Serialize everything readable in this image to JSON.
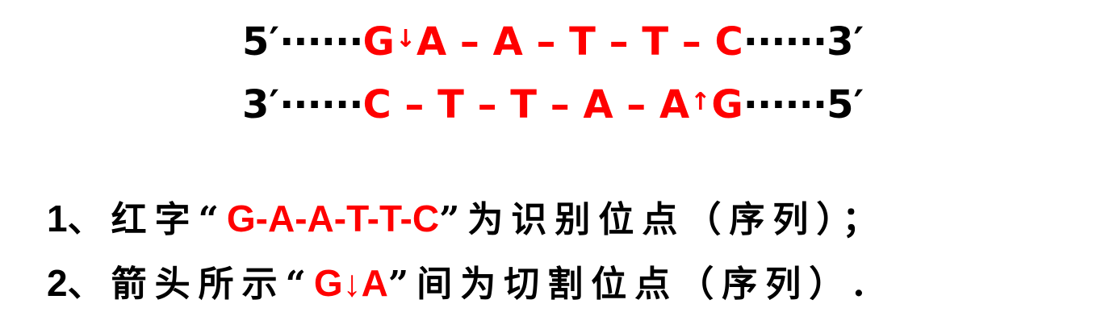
{
  "strand_top": {
    "left_end": "5′",
    "dots_left": "······",
    "first_base": "G",
    "cut_arrow": "↓",
    "rest": "A – A – T – T – C",
    "dots_right": "······",
    "right_end": "3′"
  },
  "strand_bottom": {
    "left_end": "3′",
    "dots_left": "······",
    "rest": "C – T – T – A – A",
    "cut_arrow": "↑",
    "last_base": "G",
    "dots_right": "······",
    "right_end": "5′"
  },
  "notes": {
    "line1": {
      "number": "1",
      "prefix": "、红字",
      "open_quote": "“",
      "sequence": "G-A-A-T-T-C",
      "close_quote": "”",
      "suffix": "为识别位点（序列）；"
    },
    "line2": {
      "number": "2",
      "prefix": "、箭头所示",
      "open_quote": "“",
      "sequence": "G↓A",
      "close_quote": "”",
      "suffix": "间为切割位点（序列）."
    }
  },
  "colors": {
    "highlight": "#ff0000",
    "text": "#000000"
  }
}
